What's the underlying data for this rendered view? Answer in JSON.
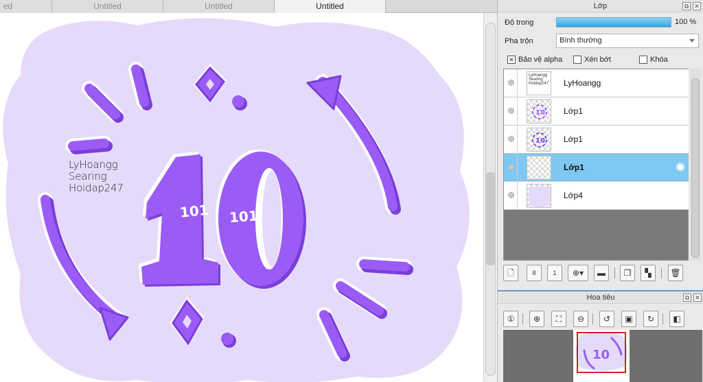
{
  "tabs": [
    {
      "label": "ed"
    },
    {
      "label": "Untitled"
    },
    {
      "label": "Untitled"
    },
    {
      "label": "Untitled"
    }
  ],
  "canvas": {
    "watermark_lines": [
      "LyHoangg",
      "Searing",
      "Hoidap247"
    ],
    "art_text": "10",
    "art_small_text": "101",
    "colors": {
      "blob": "#e6dafb",
      "purple": "#9a5cf5",
      "purple_dark": "#7a3fd8",
      "white": "#ffffff"
    }
  },
  "layer_panel": {
    "title": "Lớp",
    "opacity_label": "Độ trong",
    "opacity_value": "100 %",
    "opacity_fraction": 1.0,
    "blend_label": "Pha trộn",
    "blend_value": "Bình thường",
    "checkbox_alpha": "Bảo vệ alpha",
    "checkbox_clip": "Xén bớt",
    "checkbox_lock": "Khóa",
    "alpha_checked": true,
    "clip_checked": false,
    "lock_checked": false,
    "layers": [
      {
        "name": "LyHoangg",
        "selected": false,
        "thumb": "text"
      },
      {
        "name": "Lớp1",
        "selected": false,
        "thumb": "art"
      },
      {
        "name": "Lớp1",
        "selected": false,
        "thumb": "art"
      },
      {
        "name": "Lớp1",
        "selected": true,
        "thumb": "empty"
      },
      {
        "name": "Lớp4",
        "selected": false,
        "thumb": "blob"
      }
    ],
    "accent": "#7ec8f2"
  },
  "navigator": {
    "title": "Hoa tiêu"
  }
}
